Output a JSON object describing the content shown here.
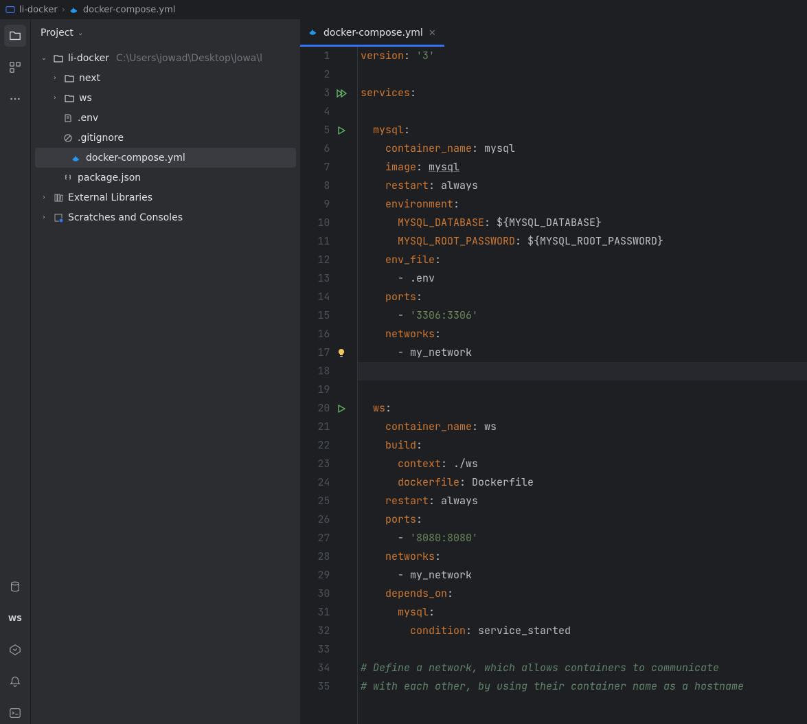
{
  "breadcrumb": {
    "project": "li-docker",
    "file": "docker-compose.yml"
  },
  "projectPanel": {
    "title": "Project"
  },
  "tree": {
    "rootName": "li-docker",
    "rootPath": "C:\\Users\\jowad\\Desktop\\Jowa\\l",
    "children": {
      "next": "next",
      "ws": "ws",
      "env": ".env",
      "gitignore": ".gitignore",
      "compose": "docker-compose.yml",
      "package": "package.json"
    },
    "extLib": "External Libraries",
    "scratches": "Scratches and Consoles"
  },
  "tab": {
    "title": "docker-compose.yml"
  },
  "toolbar": {
    "ws": "WS"
  },
  "code": {
    "lines": [
      {
        "n": 1,
        "html": "<span class='k-key'>version</span><span class='k-txt'>: </span><span class='k-str'>'3'</span>"
      },
      {
        "n": 2,
        "html": ""
      },
      {
        "n": 3,
        "html": "<span class='k-key'>services</span><span class='k-txt'>:</span>",
        "run": "double"
      },
      {
        "n": 4,
        "html": ""
      },
      {
        "n": 5,
        "html": "  <span class='k-key'>mysql</span><span class='k-txt'>:</span>",
        "run": "single"
      },
      {
        "n": 6,
        "html": "    <span class='k-key'>container_name</span><span class='k-txt'>: mysql</span>"
      },
      {
        "n": 7,
        "html": "    <span class='k-key'>image</span><span class='k-txt'>: </span><span class='k-link'>mysql</span>"
      },
      {
        "n": 8,
        "html": "    <span class='k-key'>restart</span><span class='k-txt'>: always</span>"
      },
      {
        "n": 9,
        "html": "    <span class='k-key'>environment</span><span class='k-txt'>:</span>"
      },
      {
        "n": 10,
        "html": "      <span class='k-key'>MYSQL_DATABASE</span><span class='k-txt'>: </span><span class='k-var'>${MYSQL_DATABASE}</span>"
      },
      {
        "n": 11,
        "html": "      <span class='k-key'>MYSQL_ROOT_PASSWORD</span><span class='k-txt'>: </span><span class='k-var'>${MYSQL_ROOT_PASSWORD}</span>"
      },
      {
        "n": 12,
        "html": "    <span class='k-key'>env_file</span><span class='k-txt'>:</span>"
      },
      {
        "n": 13,
        "html": "      <span class='k-txt'>- .env</span>"
      },
      {
        "n": 14,
        "html": "    <span class='k-key'>ports</span><span class='k-txt'>:</span>"
      },
      {
        "n": 15,
        "html": "      <span class='k-txt'>- </span><span class='k-str'>'3306:3306'</span>"
      },
      {
        "n": 16,
        "html": "    <span class='k-key'>networks</span><span class='k-txt'>:</span>"
      },
      {
        "n": 17,
        "html": "      <span class='k-txt'>- my_network</span>",
        "bulb": true
      },
      {
        "n": 18,
        "html": "",
        "hl": true
      },
      {
        "n": 19,
        "html": ""
      },
      {
        "n": 20,
        "html": "  <span class='k-key'>ws</span><span class='k-txt'>:</span>",
        "run": "single"
      },
      {
        "n": 21,
        "html": "    <span class='k-key'>container_name</span><span class='k-txt'>: ws</span>"
      },
      {
        "n": 22,
        "html": "    <span class='k-key'>build</span><span class='k-txt'>:</span>"
      },
      {
        "n": 23,
        "html": "      <span class='k-key'>context</span><span class='k-txt'>: ./ws</span>"
      },
      {
        "n": 24,
        "html": "      <span class='k-key'>dockerfile</span><span class='k-txt'>: Dockerfile</span>"
      },
      {
        "n": 25,
        "html": "    <span class='k-key'>restart</span><span class='k-txt'>: always</span>"
      },
      {
        "n": 26,
        "html": "    <span class='k-key'>ports</span><span class='k-txt'>:</span>"
      },
      {
        "n": 27,
        "html": "      <span class='k-txt'>- </span><span class='k-str'>'8080:8080'</span>"
      },
      {
        "n": 28,
        "html": "    <span class='k-key'>networks</span><span class='k-txt'>:</span>"
      },
      {
        "n": 29,
        "html": "      <span class='k-txt'>- my_network</span>"
      },
      {
        "n": 30,
        "html": "    <span class='k-key'>depends_on</span><span class='k-txt'>:</span>"
      },
      {
        "n": 31,
        "html": "      <span class='k-key'>mysql</span><span class='k-txt'>:</span>"
      },
      {
        "n": 32,
        "html": "        <span class='k-key'>condition</span><span class='k-txt'>: service_started</span>"
      },
      {
        "n": 33,
        "html": ""
      },
      {
        "n": 34,
        "html": "<span class='k-comment'># Define a network, which allows containers to communicate</span>"
      },
      {
        "n": 35,
        "html": "<span class='k-comment'># with each other, by using their container name as a hostname</span>"
      }
    ]
  }
}
